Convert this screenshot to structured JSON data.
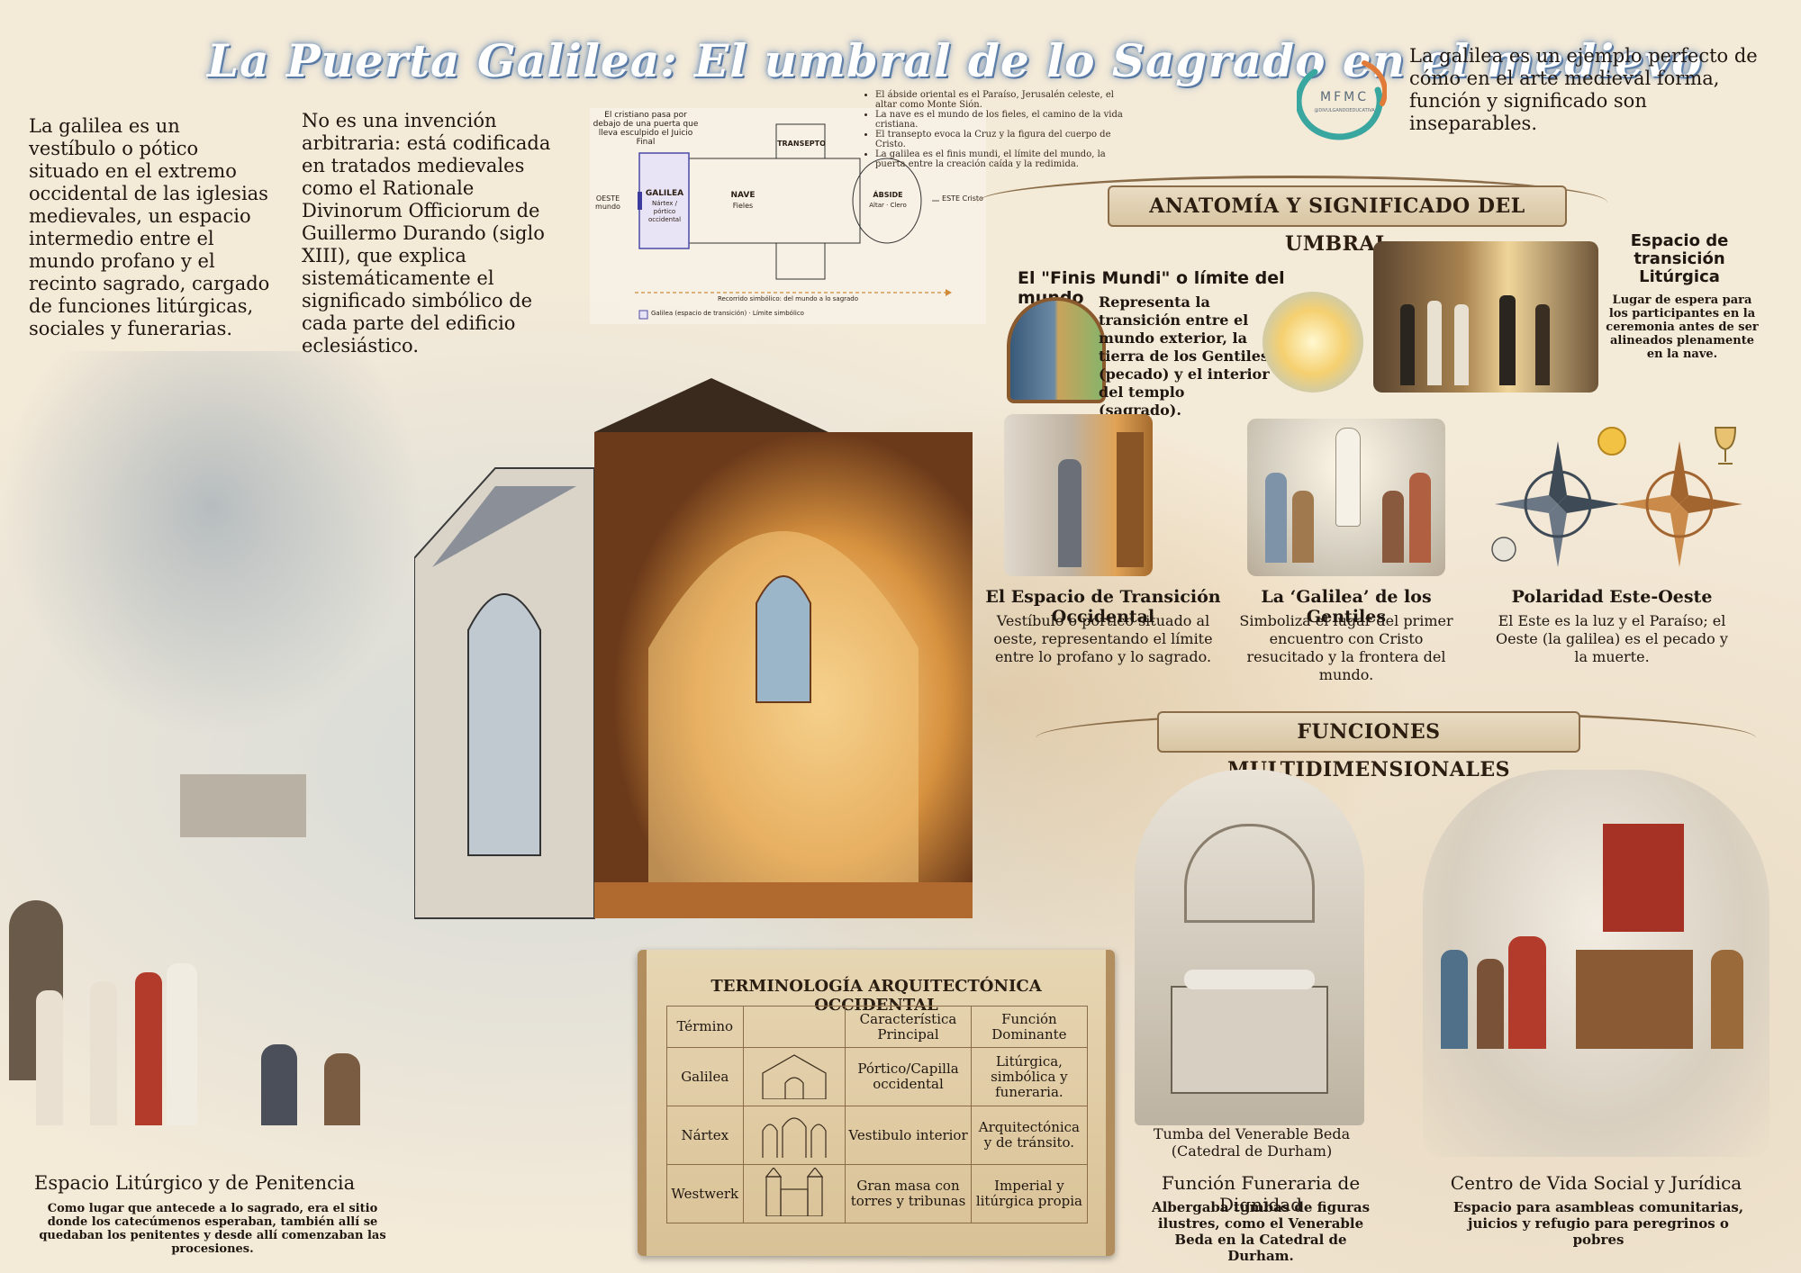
{
  "title": "La Puerta Galilea: El umbral de lo Sagrado en el medievo",
  "intro": {
    "left_paragraph": "La galilea es un vestíbulo o pótico situado en el extremo occidental de las iglesias medievales, un espacio intermedio entre el mundo profano y el recinto sagrado, cargado de funciones litúrgicas, sociales y funerarias.",
    "middle_paragraph": "No es una invención arbitraria: está codificada en tratados medievales como el Rationale Divinorum Officiorum de Guillermo Durando (siglo XIII), que explica sistemáticamente el significado simbólico de cada parte del edificio eclesiástico.",
    "right_paragraph": "La galilea es un ejemplo perfecto de cómo en el arte medieval forma, función y significado son inseparables."
  },
  "diagram": {
    "top_note": "El cristiano pasa por debajo de una puerta que lleva esculpido el Juicio Final",
    "west_label": "OESTE mundo",
    "east_label": "ESTE Cristo",
    "galilea_label": "GALILEA",
    "galilea_sub": "Nártex / pórtico occidental",
    "nave_label": "NAVE",
    "nave_sub": "Fieles",
    "transepto_label": "TRANSEPTO",
    "abside_label": "ÁBSIDE",
    "abside_sub": "Altar · Clero",
    "path_label": "Recorrido simbólico: del mundo a lo sagrado",
    "legend": "Galilea (espacio de transición) · Límite simbólico",
    "notes": [
      "El ábside oriental es el Paraíso, Jerusalén celeste, el altar como Monte Sión.",
      "La nave es el mundo de los fieles, el camino de la vida cristiana.",
      "El transepto evoca la Cruz y la figura del cuerpo de Cristo.",
      "La galilea es el finis mundi, el límite del mundo, la puerta entre la creación caída y la redimida."
    ]
  },
  "logo": {
    "letters": "MFMC",
    "sub": "@DIVULGANDOEDUCATIVA"
  },
  "anatomy": {
    "banner": "ANATOMÍA Y SIGNIFICADO DEL UMBRAL",
    "finis_title": "El \"Finis Mundi\" o límite del mundo",
    "finis_text": "Representa la transición entre el mundo exterior, la tierra de los Gentiles (pecado) y el interior del templo (sagrado).",
    "transicion_title": "Espacio de transición Litúrgica",
    "transicion_text": "Lugar de espera para los participantes en la ceremonia antes de ser alineados plenamente en la nave.",
    "cards": [
      {
        "title": "El Espacio de Transición Occidental",
        "text": "Vestíbulo o pórtico situado al oeste, representando el límite entre lo profano y lo sagrado."
      },
      {
        "title": "La ‘Galilea’ de los Gentiles",
        "text": "Simboliza el lugar del primer encuentro con Cristo resucitado y la frontera del mundo."
      },
      {
        "title": "Polaridad Este-Oeste",
        "text": "El Este es la luz y el Paraíso; el Oeste (la galilea) es el pecado y la muerte."
      }
    ]
  },
  "functions": {
    "banner": "FUNCIONES MULTIDIMENSIONALES",
    "tomb_caption": "Tumba del Venerable Beda (Catedral de Durham)",
    "funeraria_title": "Función Funeraria de Dignidad",
    "funeraria_text": "Albergaba tumbas de figuras ilustres, como el Venerable Beda en la Catedral de Durham.",
    "social_title": "Centro de Vida Social y Jurídica",
    "social_text": "Espacio para asambleas comunitarias, juicios y refugio para peregrinos o pobres"
  },
  "liturgico": {
    "title": "Espacio Litúrgico y de Penitencia",
    "text": "Como lugar que antecede a lo sagrado, era el sitio donde los catecúmenos esperaban, también allí se quedaban los penitentes y desde allí comenzaban las procesiones."
  },
  "terminology": {
    "title": "TERMINOLOGÍA ARQUITECTÓNICA OCCIDENTAL",
    "headers": [
      "Término",
      "",
      "Característica Principal",
      "Función Dominante"
    ],
    "rows": [
      {
        "term": "Galilea",
        "feature": "Pórtico/Capilla occidental",
        "function": "Litúrgica, simbólica y funeraria."
      },
      {
        "term": "Nártex",
        "feature": "Vestibulo interior",
        "function": "Arquitectónica y de tránsito."
      },
      {
        "term": "Westwerk",
        "feature": "Gran masa con torres y tribunas",
        "function": "Imperial y litúrgica propia"
      }
    ]
  },
  "colors": {
    "parchment": "#f4ead8",
    "title_glow": "#6d8fb8",
    "frame_brown": "#8a6d48",
    "warm_gold": "#e0a356"
  }
}
